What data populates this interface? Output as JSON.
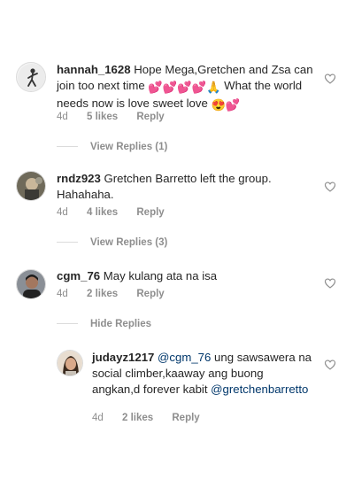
{
  "comments": [
    {
      "username": "hannah_1628",
      "text_before": "Hope Mega,Gretchen and Zsa can join too next time",
      "emojis": "💕💕💕💕🙏",
      "text_after": "What the world needs now is love sweet love",
      "emojis_end": "😍💕",
      "age": "4d",
      "likes": "5 likes",
      "reply_label": "Reply",
      "view_replies": "View Replies (1)"
    },
    {
      "username": "rndz923",
      "text": "Gretchen Barretto left the group. Hahahaha.",
      "age": "4d",
      "likes": "4 likes",
      "reply_label": "Reply",
      "view_replies": "View Replies (3)"
    },
    {
      "username": "cgm_76",
      "text": "May kulang ata na isa",
      "age": "4d",
      "likes": "2 likes",
      "reply_label": "Reply",
      "hide_replies": "Hide Replies"
    },
    {
      "username": "judayz1217",
      "mention": "@cgm_76",
      "text": "ung sawsawera na social climber,kaaway ang buong angkan,d forever kabit",
      "mention_end": "@gretchenbarretto",
      "age": "4d",
      "likes": "2 likes",
      "reply_label": "Reply"
    }
  ],
  "icons": {
    "like": "heart-outline-icon",
    "avatar": "avatar"
  }
}
